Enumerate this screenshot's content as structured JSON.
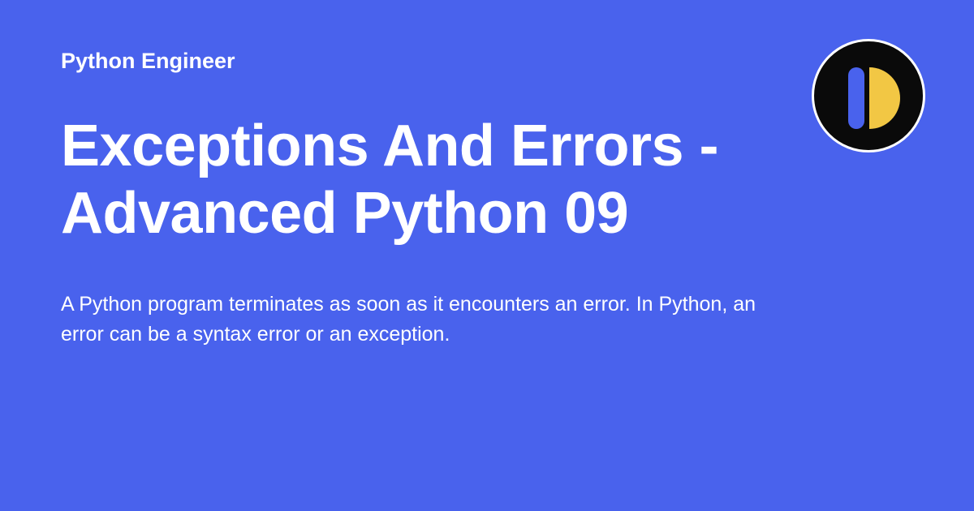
{
  "site_name": "Python Engineer",
  "title": "Exceptions And Errors - Advanced Python 09",
  "description": "A Python program terminates as soon as it encounters an error. In Python, an error can be a syntax error or an exception.",
  "colors": {
    "background": "#4962ed",
    "text": "#ffffff",
    "logo_bg": "#0a0a0a",
    "logo_accent_blue": "#4962ed",
    "logo_accent_yellow": "#f2c744"
  }
}
